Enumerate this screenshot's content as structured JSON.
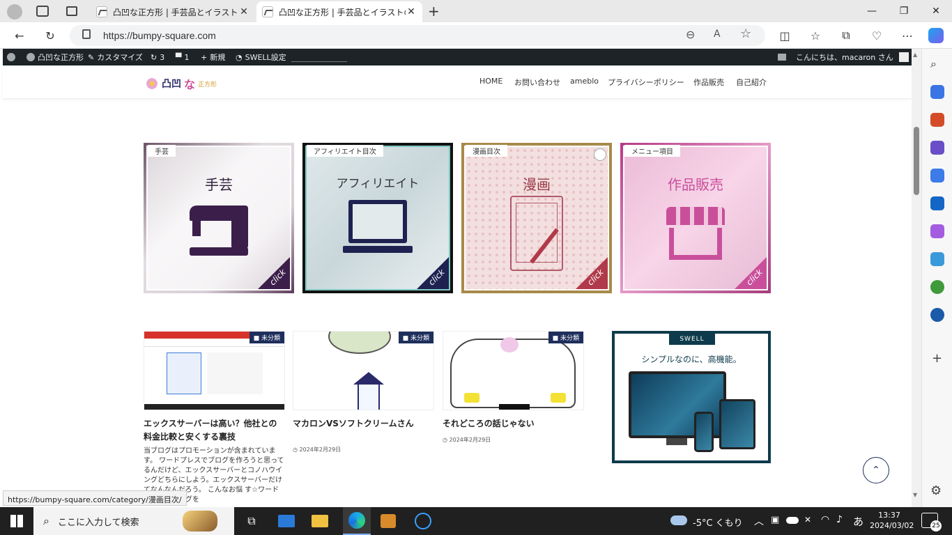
{
  "browser": {
    "tabs": [
      {
        "title": "凸凹な正方形 | 手芸品とイラストの",
        "active": false
      },
      {
        "title": "凸凹な正方形 | 手芸品とイラストの",
        "active": true
      }
    ],
    "url": "https://bumpy-square.com",
    "status_url": "https://bumpy-square.com/category/漫画目次/"
  },
  "wp_admin_bar": {
    "site_name": "凸凹な正方形",
    "customize": "カスタマイズ",
    "updates": "3",
    "comments": "1",
    "new": "新規",
    "swell": "SWELL設定",
    "greeting": "こんにちは、macaron さん"
  },
  "site": {
    "logo_chars": [
      "凸凹",
      "な",
      "正方形"
    ],
    "nav": [
      "HOME",
      "お問い合わせ",
      "ameblo",
      "プライバシーポリシー",
      "作品販売",
      "自己紹介"
    ]
  },
  "cards": [
    {
      "tag": "手芸",
      "title": "手芸",
      "click": "click",
      "icon": "sewing-machine-icon"
    },
    {
      "tag": "アフィリエイト目次",
      "title": "アフィリエイト",
      "click": "click",
      "icon": "laptop-icon"
    },
    {
      "tag": "漫画目次",
      "title": "漫画",
      "click": "click",
      "icon": "tablet-pen-icon"
    },
    {
      "tag": "メニュー項目",
      "title": "作品販売",
      "click": "click",
      "icon": "shop-icon"
    }
  ],
  "posts": [
    {
      "category": "未分類",
      "title": "エックスサーバーは高い？他社との料金比較と安くする裏技",
      "date": "",
      "excerpt": "当ブログはプロモーションが含まれています。 ワードプレスでブログを作ろうと思ってるんだけど、エックスサーバーとコノハウイングどちらにしよう。エックスサーバーだけ てなんなんだろう。 こんなお悩 す☆ワードプレスでブログを"
    },
    {
      "category": "未分類",
      "title": "マカロンVSソフトクリームさん",
      "date": "2024年2月29日",
      "excerpt": ""
    },
    {
      "category": "未分類",
      "title": "それどころの話じゃない",
      "date": "2024年2月29日",
      "excerpt": ""
    }
  ],
  "swell_ad": {
    "brand": "SWELL",
    "tagline": "シンプルなのに、高機能。"
  },
  "taskbar": {
    "search_placeholder": "ここに入力して検索",
    "weather": "-5°C くもり",
    "ime": "あ",
    "time": "13:37",
    "date": "2024/03/02",
    "notifications": "25"
  },
  "colors": {
    "accent_pink": "#c94f9b",
    "navy": "#1e2f5c",
    "wpbar": "#1d2327",
    "taskbar": "#202020"
  }
}
